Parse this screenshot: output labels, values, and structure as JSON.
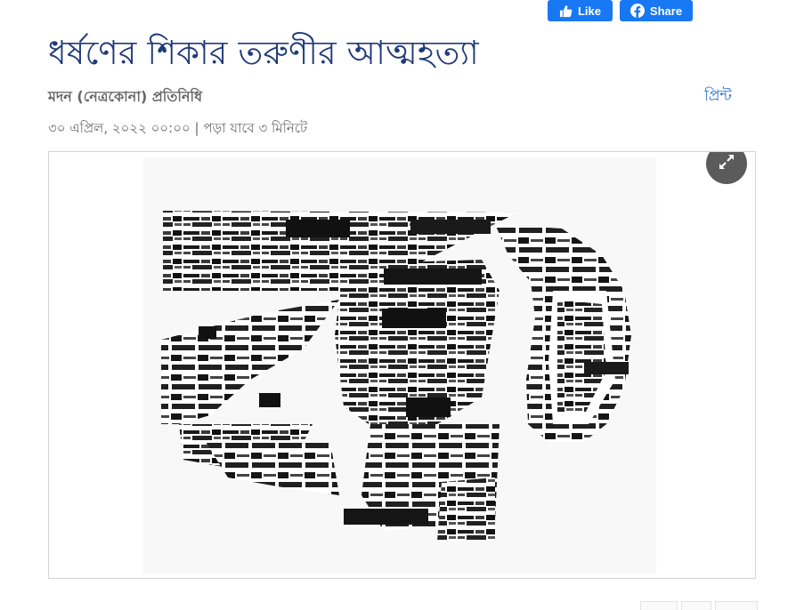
{
  "article": {
    "headline": "ধর্ষণের শিকার তরুণীর আত্মহত্যা",
    "byline": "মদন (নেত্রকোনা) প্রতিনিধি",
    "dateline": "৩০ এপ্রিল, ২০২২ ০০:০০ | পড়া যাবে ৩ মিনিটে"
  },
  "social": {
    "like_label": "Like",
    "share_label": "Share",
    "print_label": "প্রিন্ট",
    "facebook_color": "#1877f2"
  },
  "image": {
    "logo_words": [
      "সম্পাদকীয়",
      "বাউল মেলা",
      "খবর কথায় কথায়",
      "শিল্প বাণিজ্য",
      "খবর খেলা",
      "আবহাওয়া",
      "প্রিয় দেশ",
      "A2Z",
      "পড়ালেখা",
      "অবসর",
      "টেলিফোন",
      "জ্ঞানের আলো",
      "স্বাস্থ্য",
      "ধর্ম",
      "তরুণ ডিজিটাল",
      "চিঠি",
      "টুকরো খবর",
      "খেলাধুলা"
    ],
    "expand_icon": "expand-arrows-icon"
  },
  "colors": {
    "headline": "#1f3a78",
    "print_link": "#2c6fcf"
  }
}
